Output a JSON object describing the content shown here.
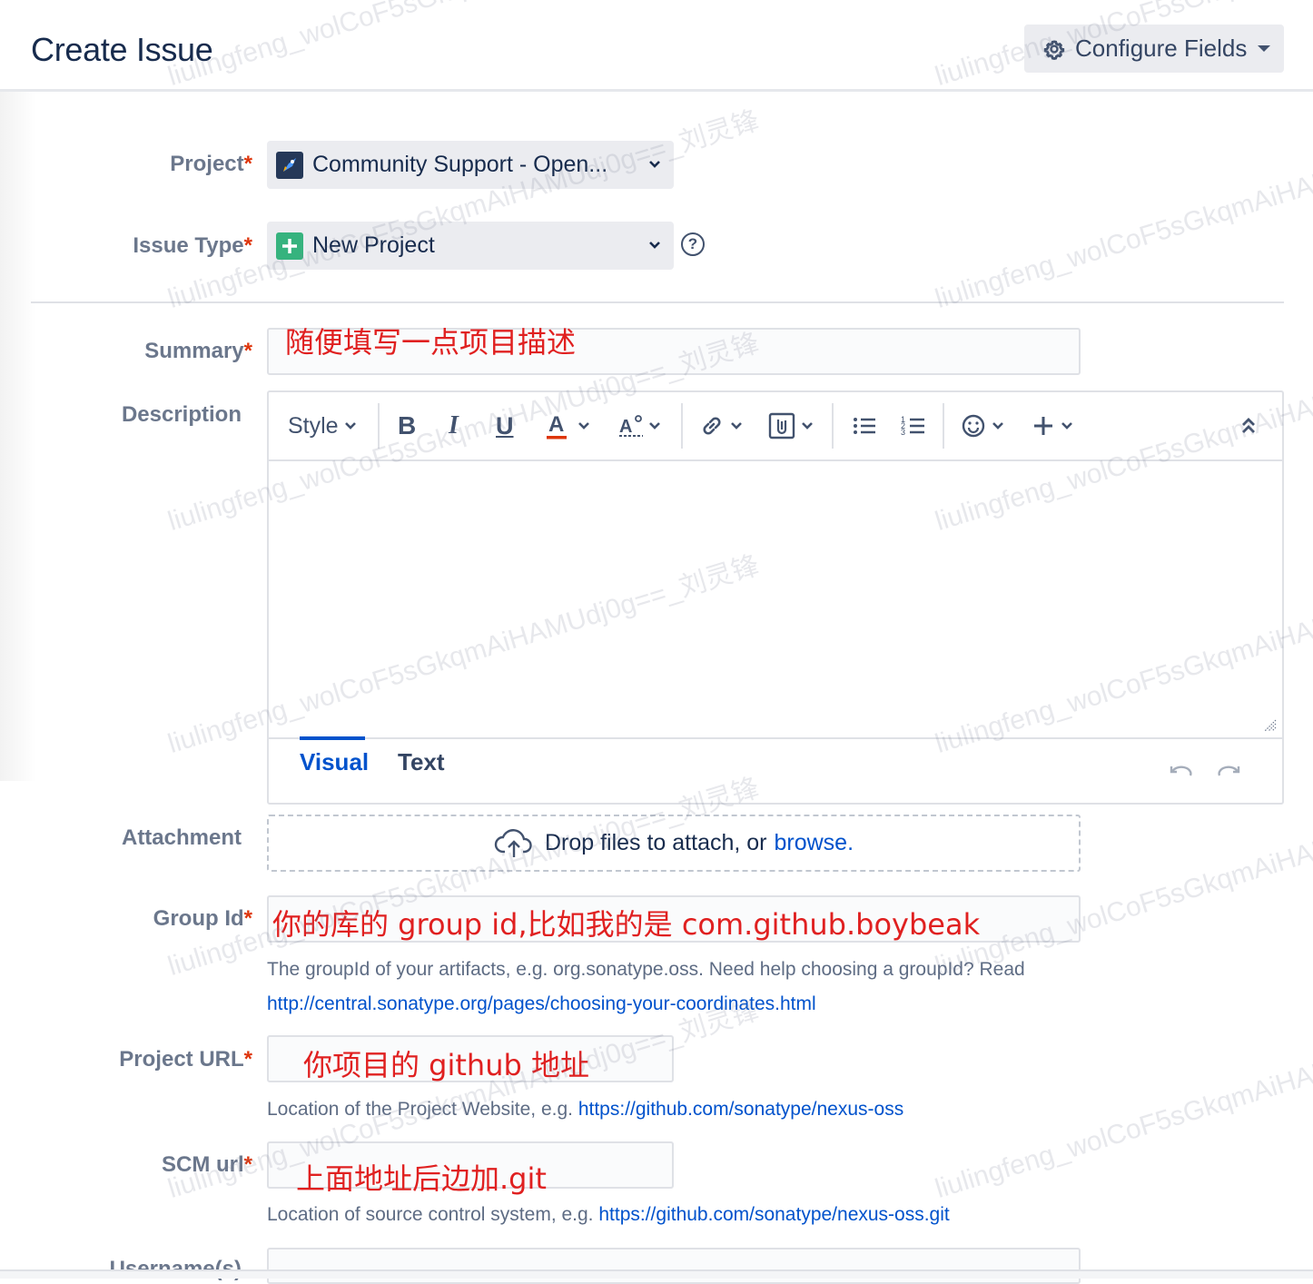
{
  "header": {
    "title": "Create Issue",
    "configure_label": "Configure Fields"
  },
  "fields": {
    "project": {
      "label": "Project",
      "value": "Community Support - Open..."
    },
    "issue_type": {
      "label": "Issue Type",
      "value": "New Project"
    },
    "summary": {
      "label": "Summary",
      "annotation": "随便填写一点项目描述"
    },
    "description": {
      "label": "Description"
    },
    "attachment": {
      "label": "Attachment",
      "drop_text": "Drop files to attach, or",
      "browse_link": "browse."
    },
    "group_id": {
      "label": "Group Id",
      "annotation": "你的库的 group id,比如我的是 com.github.boybeak",
      "help": "The groupId of your artifacts, e.g. org.sonatype.oss. Need help choosing a groupId? Read",
      "help_link": "http://central.sonatype.org/pages/choosing-your-coordinates.html"
    },
    "project_url": {
      "label": "Project URL",
      "annotation": "你项目的 github 地址",
      "help": "Location of the Project Website, e.g.",
      "help_link": "https://github.com/sonatype/nexus-oss"
    },
    "scm_url": {
      "label": "SCM url",
      "annotation": "上面地址后边加.git",
      "help": "Location of source control system, e.g.",
      "help_link": "https://github.com/sonatype/nexus-oss.git"
    },
    "usernames": {
      "label": "Username(s)"
    }
  },
  "required_marker": "*",
  "editor": {
    "style_label": "Style",
    "tab_visual": "Visual",
    "tab_text": "Text"
  },
  "watermark": {
    "text_a": "liulingfeng_wolCoF5sGkqmAiHAMUdj0g==_刘灵锋"
  },
  "colors": {
    "required": "#de350b",
    "link": "#0052cc",
    "annotation": "#e02020"
  }
}
